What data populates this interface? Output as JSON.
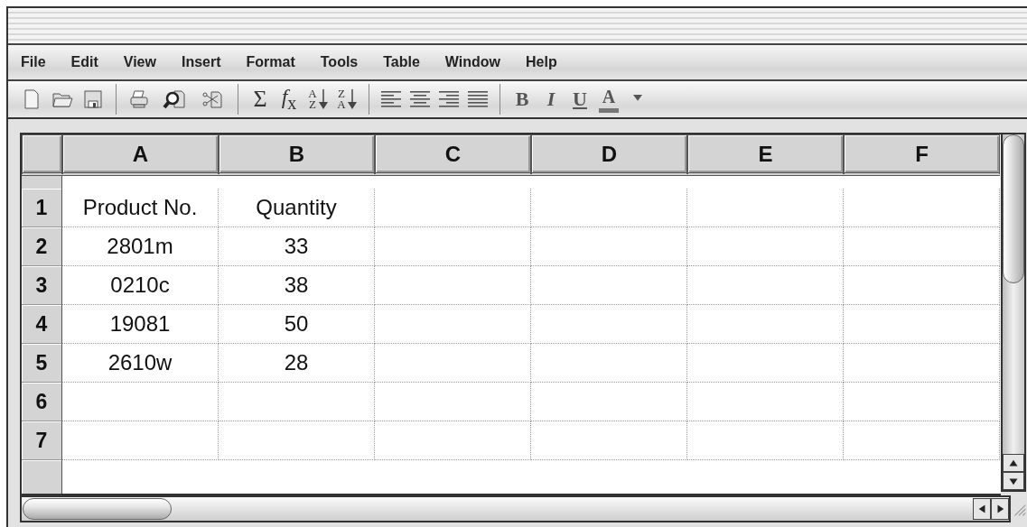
{
  "menu": [
    "File",
    "Edit",
    "View",
    "Insert",
    "Format",
    "Tools",
    "Table",
    "Window",
    "Help"
  ],
  "toolbar": {
    "sum": "Σ",
    "function": "*f*$_{x}$",
    "sort_ascending": [
      "A",
      "Z"
    ],
    "sort_descending": [
      "Z",
      "A"
    ],
    "bold": "B",
    "italic": "I",
    "underline": "U",
    "font_color": "A"
  },
  "sheet": {
    "columns": [
      "A",
      "B",
      "C",
      "D",
      "E",
      "F"
    ],
    "rows": [
      {
        "header": "1",
        "cells": [
          "Product No.",
          "Quantity"
        ]
      },
      {
        "header": "2",
        "cells": [
          "2801m",
          "33"
        ]
      },
      {
        "header": "3",
        "cells": [
          "0210c",
          "38"
        ]
      },
      {
        "header": "4",
        "cells": [
          "19081",
          "50"
        ]
      },
      {
        "header": "5",
        "cells": [
          "2610w",
          "28"
        ]
      },
      {
        "header": "6"
      },
      {
        "header": "7"
      }
    ]
  }
}
